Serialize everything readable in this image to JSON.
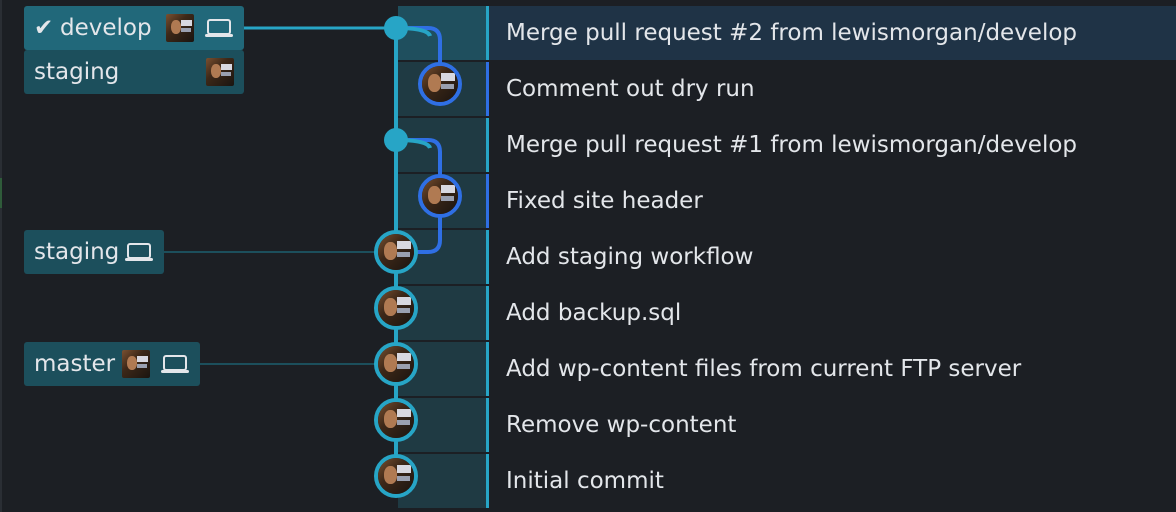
{
  "colors": {
    "background": "#1c1f24",
    "main_branch": "#27a5c6",
    "side_branch": "#2f6fe4",
    "label_bg": "#1c4f5c",
    "label_active_bg": "#21687a",
    "selected_row_bg": "#1f3346",
    "text": "#e3e6ea"
  },
  "branches": [
    {
      "name": "develop",
      "checked_out": true,
      "has_avatar": true,
      "has_laptop": true,
      "icons": [
        "check-icon",
        "avatar",
        "laptop-icon"
      ]
    },
    {
      "name": "staging",
      "checked_out": false,
      "has_avatar": true,
      "has_laptop": false,
      "icons": [
        "avatar"
      ]
    },
    {
      "name": "staging",
      "checked_out": false,
      "has_avatar": false,
      "has_laptop": true,
      "icons": [
        "laptop-icon"
      ]
    },
    {
      "name": "master",
      "checked_out": false,
      "has_avatar": true,
      "has_laptop": true,
      "icons": [
        "avatar",
        "laptop-icon"
      ]
    }
  ],
  "commits": [
    {
      "message": "Merge pull request #2 from lewismorgan/develop",
      "lane": "main",
      "type": "merge",
      "selected": true
    },
    {
      "message": "Comment out dry run",
      "lane": "side",
      "type": "commit",
      "selected": false
    },
    {
      "message": "Merge pull request #1 from lewismorgan/develop",
      "lane": "main",
      "type": "merge",
      "selected": false
    },
    {
      "message": "Fixed site header",
      "lane": "side",
      "type": "commit",
      "selected": false
    },
    {
      "message": "Add staging workflow",
      "lane": "main",
      "type": "commit",
      "selected": false
    },
    {
      "message": "Add backup.sql",
      "lane": "main",
      "type": "commit",
      "selected": false
    },
    {
      "message": "Add wp-content files from current FTP server",
      "lane": "main",
      "type": "commit",
      "selected": false
    },
    {
      "message": "Remove wp-content",
      "lane": "main",
      "type": "commit",
      "selected": false
    },
    {
      "message": "Initial commit",
      "lane": "main",
      "type": "commit",
      "selected": false
    }
  ]
}
